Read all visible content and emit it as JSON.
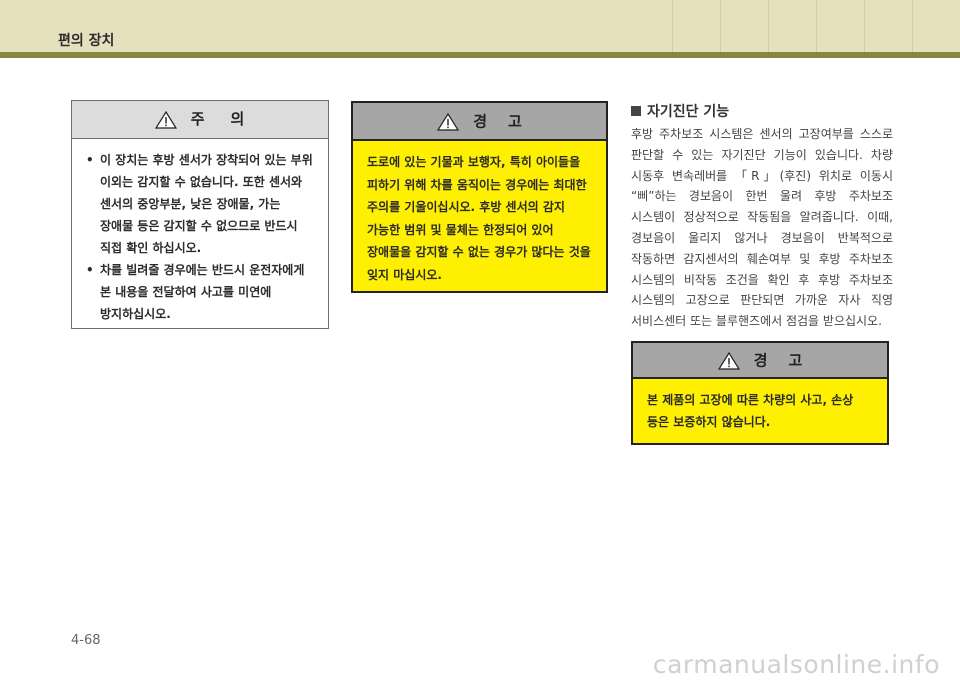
{
  "header": {
    "title": "편의 장치"
  },
  "caution": {
    "title": "주    의",
    "items": [
      "이 장치는 후방 센서가 장착되어 있는 부위 이외는 감지할 수 없습니다. 또한 센서와 센서의 중앙부분, 낮은 장애물, 가는 장애물 등은 감지할 수 없으므로 반드시 직접 확인 하십시오.",
      "차를 빌려줄 경우에는 반드시 운전자에게 본 내용을 전달하여 사고를 미연에 방지하십시오."
    ]
  },
  "warning_1": {
    "title": "경    고",
    "body": "도로에 있는 기물과 보행자, 특히 아이들을 피하기 위해 차를 움직이는 경우에는 최대한 주의를 기울이십시오. 후방 센서의 감지 가능한 범위 및 물체는 한정되어 있어 장애물을 감지할 수 없는 경우가 많다는 것을 잊지 마십시오."
  },
  "self_diagnosis": {
    "title": "자기진단 기능",
    "body": "후방 주차보조 시스템은 센서의 고장여부를 스스로 판단할 수 있는 자기진단 기능이 있습니다. 차량 시동후 변속레버를 「R」(후진) 위치로 이동시 “삐”하는 경보음이 한번 울려 후방 주차보조 시스템이 정상적으로 작동됨을 알려줍니다. 이때, 경보음이 울리지 않거나 경보음이 반복적으로 작동하면 감지센서의 훼손여부 및 후방 주차보조 시스템의 비작동 조건을 확인 후 후방 주차보조 시스템의 고장으로 판단되면 가까운 자사 직영 서비스센터 또는 블루핸즈에서 점검을 받으십시오."
  },
  "warning_2": {
    "title": "경    고",
    "body": "본 제품의 고장에 따른 차량의 사고, 손상 등은 보증하지 않습니다."
  },
  "page_number": "4-68",
  "watermark": "carmanualsonline.info",
  "colors": {
    "header_bg": "#e6e1bd",
    "header_rule": "#8a8640",
    "warning_bg": "#ffef00",
    "warning_head": "#a6a6a6",
    "caution_head": "#dcdcdc"
  },
  "icons": {
    "alert": "warning-triangle-icon"
  }
}
